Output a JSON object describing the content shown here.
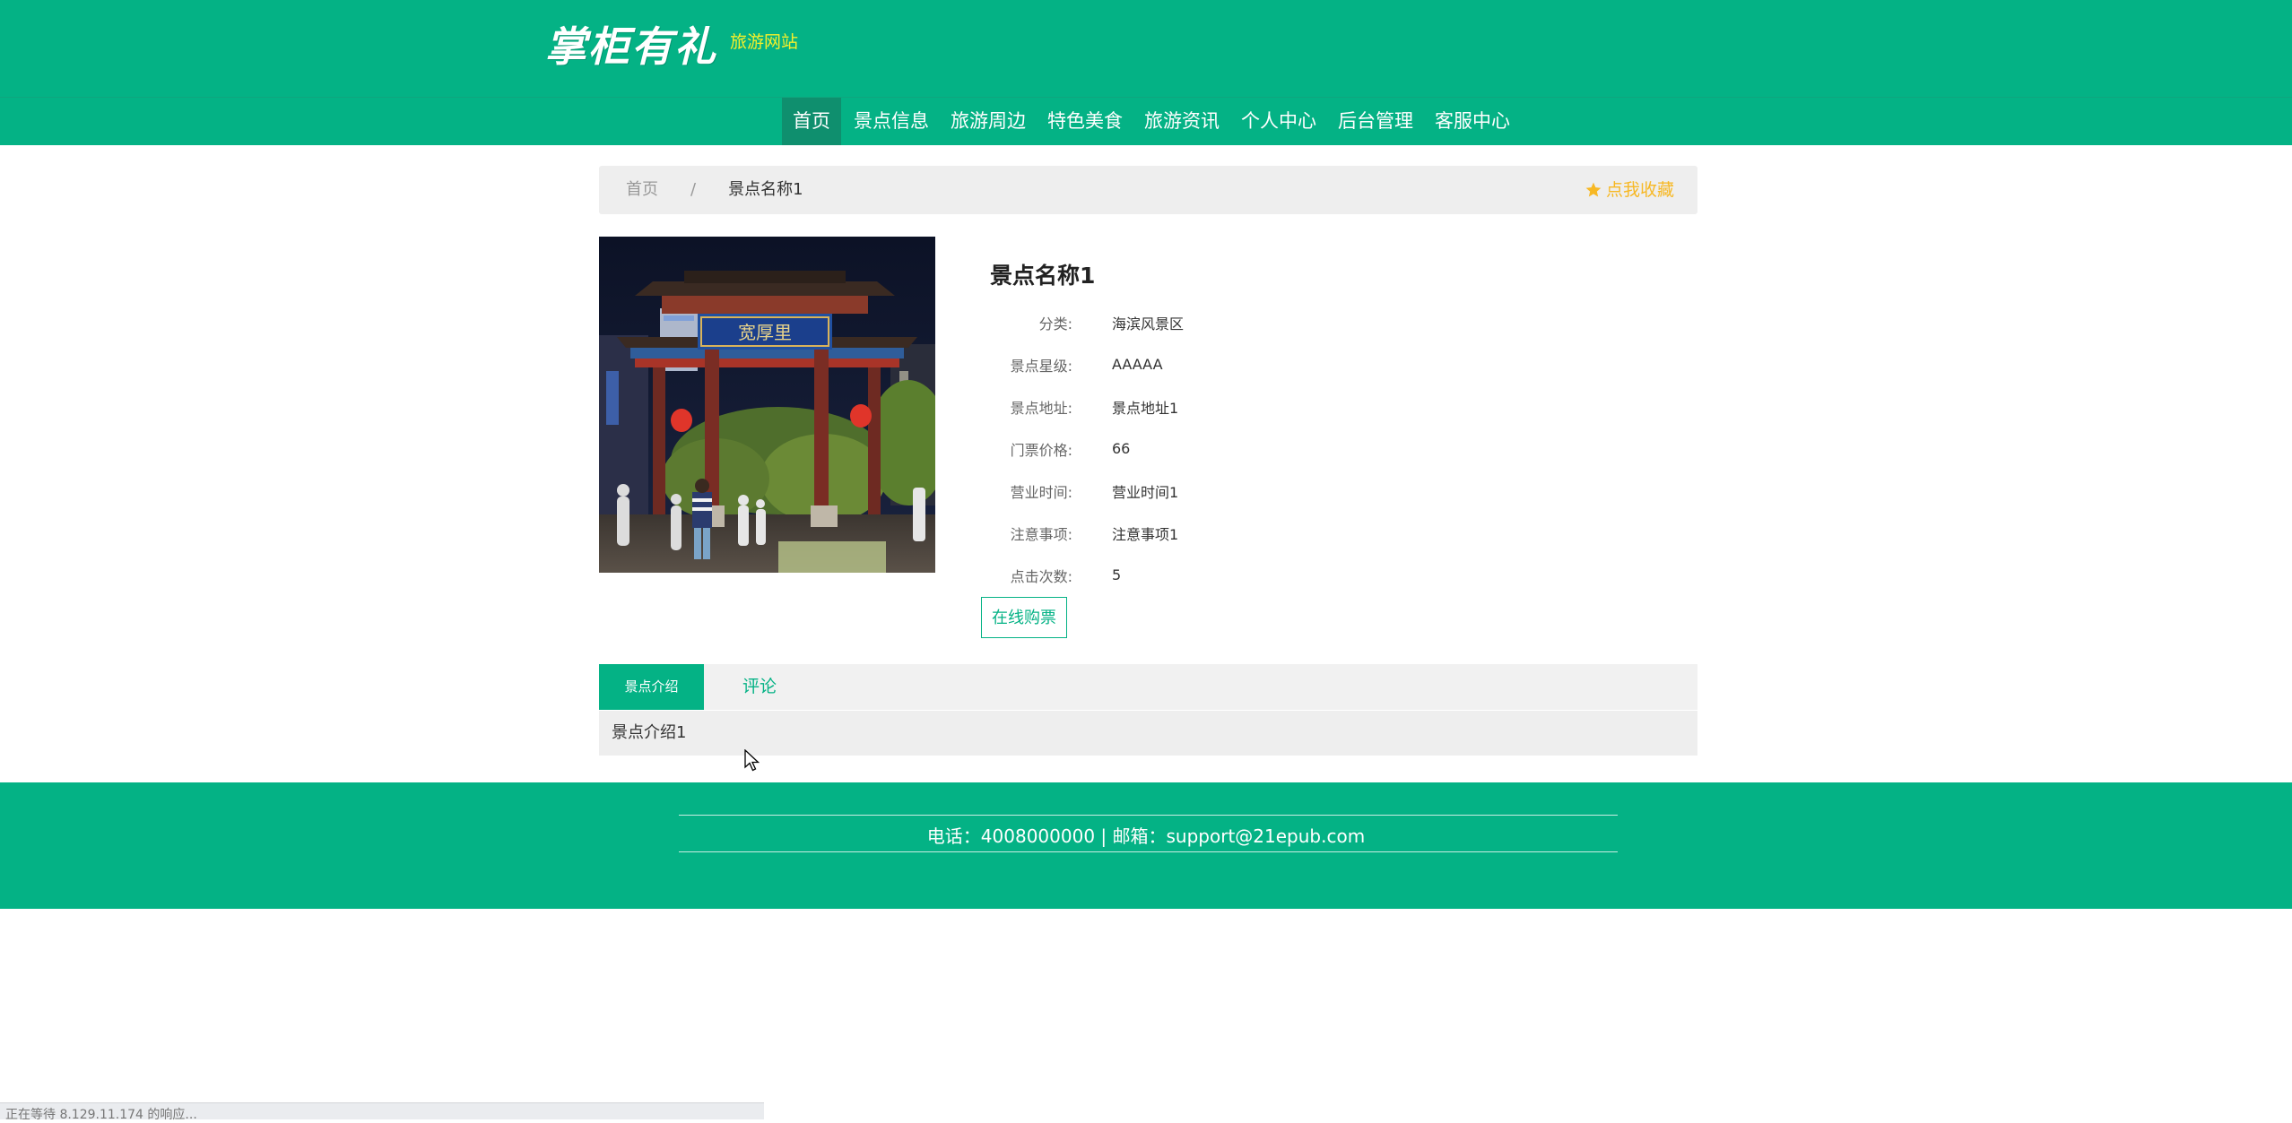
{
  "header": {
    "logo_text": "掌柜有礼",
    "logo_sub": "旅游网站"
  },
  "nav": {
    "items": [
      "首页",
      "景点信息",
      "旅游周边",
      "特色美食",
      "旅游资讯",
      "个人中心",
      "后台管理",
      "客服中心"
    ],
    "active": "首页"
  },
  "breadcrumb": {
    "home": "首页",
    "separator": "/",
    "current": "景点名称1",
    "favorite": "点我收藏"
  },
  "detail": {
    "title": "景点名称1",
    "fields": [
      {
        "label": "分类:",
        "value": "海滨风景区"
      },
      {
        "label": "景点星级:",
        "value": "AAAAA"
      },
      {
        "label": "景点地址:",
        "value": "景点地址1"
      },
      {
        "label": "门票价格:",
        "value": "66"
      },
      {
        "label": "营业时间:",
        "value": "营业时间1"
      },
      {
        "label": "注意事项:",
        "value": "注意事项1"
      },
      {
        "label": "点击次数:",
        "value": "5"
      }
    ],
    "buy_label": "在线购票",
    "photo_sign": "宽厚里"
  },
  "tabs": {
    "intro": "景点介绍",
    "comment": "评论",
    "content": "景点介绍1"
  },
  "footer": {
    "contact": "电话：4008000000 | 邮箱：support@21epub.com"
  },
  "status_bar": {
    "text": "正在等待 8.129.11.174 的响应..."
  },
  "colors": {
    "brand": "#04b285",
    "nav_active": "#0f8f6e",
    "favorite": "#f7b824",
    "logo_sub": "#f5f02a"
  },
  "icons": [
    "star-icon",
    "cursor-icon"
  ]
}
